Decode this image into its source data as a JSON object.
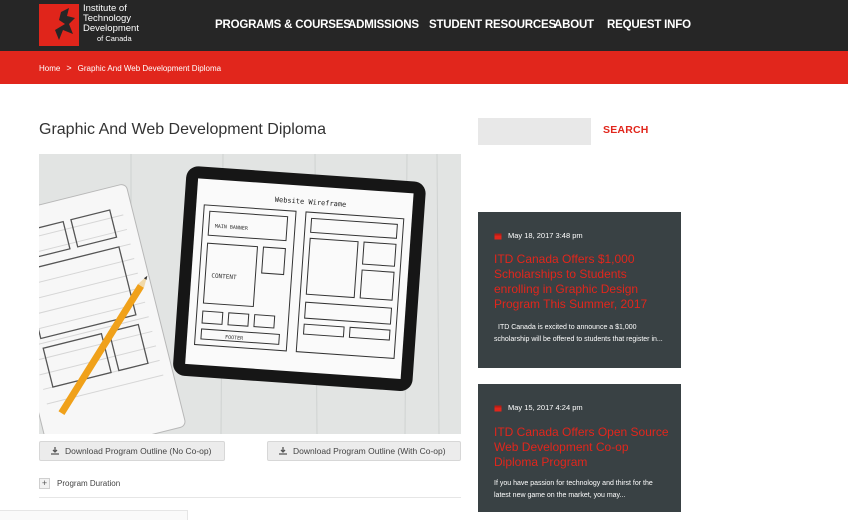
{
  "brand": {
    "line1": "Institute of",
    "line2": "Technology",
    "line3": "Development",
    "line4": "of Canada"
  },
  "nav": {
    "items": [
      {
        "label": "PROGRAMS & COURSES"
      },
      {
        "label": "ADMISSIONS"
      },
      {
        "label": "STUDENT RESOURCES"
      },
      {
        "label": "ABOUT"
      },
      {
        "label": "REQUEST INFO"
      }
    ]
  },
  "breadcrumb": {
    "home": "Home",
    "separator": ">",
    "current": "Graphic And Web Development Diploma"
  },
  "page": {
    "title": "Graphic And Web Development Diploma",
    "hero_sketch": {
      "heading": "Website Wireframe",
      "label_a": "MAIN BANNER",
      "label_b": "CONTENT",
      "label_c": "FOOTER"
    }
  },
  "downloads": {
    "no_coop": "Download Program Outline (No Co-op)",
    "with_coop": "Download Program Outline (With Co-op)"
  },
  "accordion": {
    "toggle": "+",
    "label": "Program Duration"
  },
  "sidebar": {
    "search": {
      "value": "",
      "placeholder": "",
      "button": "SEARCH"
    },
    "posts": [
      {
        "date": "May 18, 2017 3:48 pm",
        "title": "ITD Canada Offers $1,000 Scholarships to Students enrolling in Graphic Design Program This Summer, 2017",
        "excerpt": "ITD Canada is excited to announce a $1,000 scholarship will be offered to students that register in..."
      },
      {
        "date": "May 15, 2017 4:24 pm",
        "title": "ITD Canada Offers Open Source Web Development Co-op Diploma Program",
        "excerpt": "If you have passion for technology and thirst for the latest new game on the market, you may..."
      }
    ]
  },
  "colors": {
    "brand_red": "#e1261c",
    "header_dark": "#262626",
    "card_dark": "#394144"
  }
}
